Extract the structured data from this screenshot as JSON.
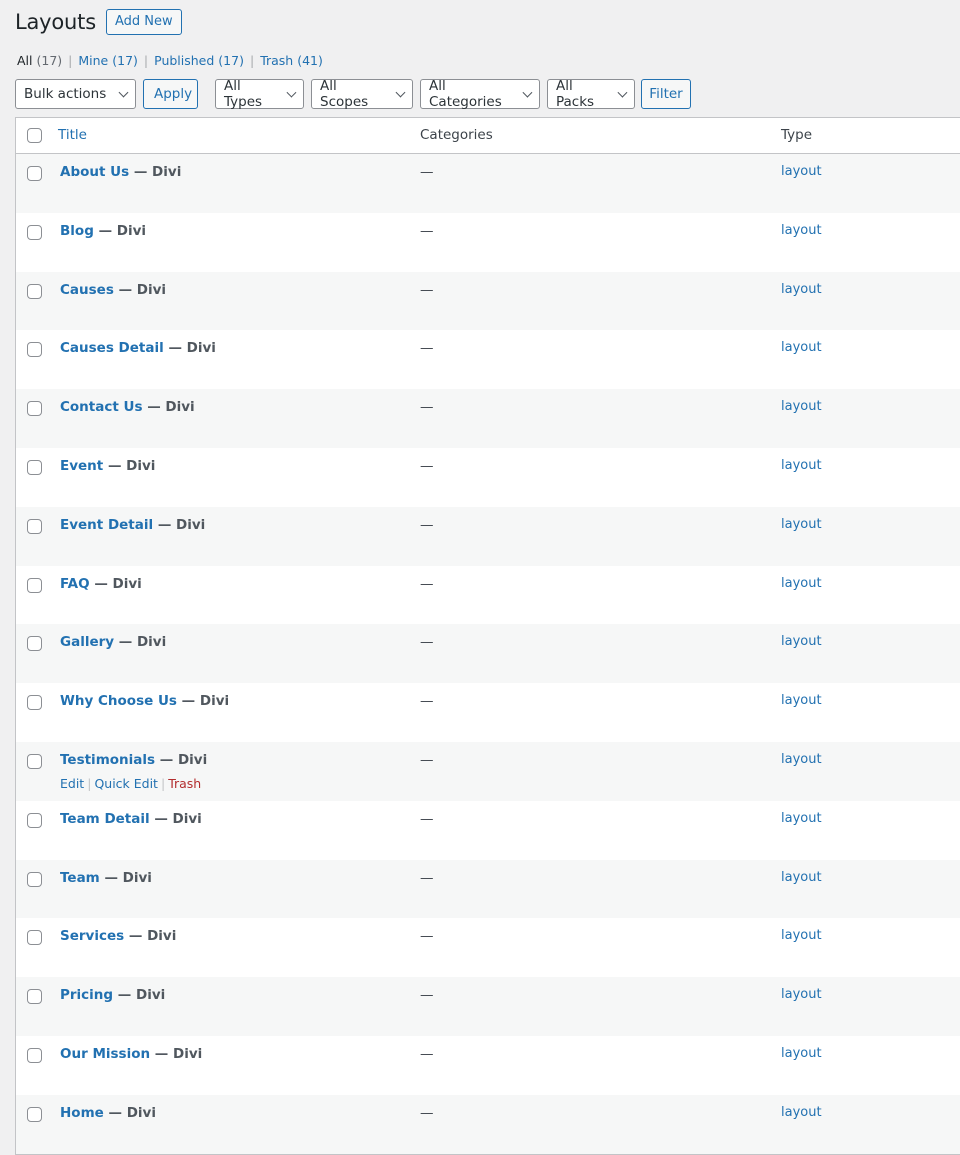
{
  "header": {
    "title": "Layouts",
    "add_new": "Add New"
  },
  "views": [
    {
      "label": "All",
      "count": "(17)",
      "current": true
    },
    {
      "label": "Mine",
      "count": "(17)",
      "current": false
    },
    {
      "label": "Published",
      "count": "(17)",
      "current": false
    },
    {
      "label": "Trash",
      "count": "(41)",
      "current": false
    }
  ],
  "tablenav": {
    "bulk_actions": "Bulk actions",
    "apply": "Apply",
    "types": "All Types",
    "scopes": "All Scopes",
    "categories": "All Categories",
    "packs": "All Packs",
    "filter": "Filter"
  },
  "columns": {
    "title": "Title",
    "categories": "Categories",
    "type": "Type"
  },
  "rows": [
    {
      "title": "About Us",
      "state": "— Divi",
      "categories": "—",
      "type": "layout"
    },
    {
      "title": "Blog",
      "state": "— Divi",
      "categories": "—",
      "type": "layout"
    },
    {
      "title": "Causes",
      "state": "— Divi",
      "categories": "—",
      "type": "layout"
    },
    {
      "title": "Causes Detail",
      "state": "— Divi",
      "categories": "—",
      "type": "layout"
    },
    {
      "title": "Contact Us",
      "state": "— Divi",
      "categories": "—",
      "type": "layout"
    },
    {
      "title": "Event",
      "state": "— Divi",
      "categories": "—",
      "type": "layout"
    },
    {
      "title": "Event Detail",
      "state": "— Divi",
      "categories": "—",
      "type": "layout"
    },
    {
      "title": "FAQ",
      "state": "— Divi",
      "categories": "—",
      "type": "layout"
    },
    {
      "title": "Gallery",
      "state": "— Divi",
      "categories": "—",
      "type": "layout"
    },
    {
      "title": "Why Choose Us",
      "state": "— Divi",
      "categories": "—",
      "type": "layout"
    },
    {
      "title": "Testimonials",
      "state": "— Divi",
      "categories": "—",
      "type": "layout",
      "actions": [
        "Edit",
        "Quick Edit",
        "Trash"
      ]
    },
    {
      "title": "Team Detail",
      "state": "— Divi",
      "categories": "—",
      "type": "layout"
    },
    {
      "title": "Team",
      "state": "— Divi",
      "categories": "—",
      "type": "layout"
    },
    {
      "title": "Services",
      "state": "— Divi",
      "categories": "—",
      "type": "layout"
    },
    {
      "title": "Pricing",
      "state": "— Divi",
      "categories": "—",
      "type": "layout"
    },
    {
      "title": "Our Mission",
      "state": "— Divi",
      "categories": "—",
      "type": "layout"
    },
    {
      "title": "Home",
      "state": "— Divi",
      "categories": "—",
      "type": "layout"
    }
  ],
  "colors": {
    "link": "#2271b1",
    "trash": "#b32d2e",
    "row_alt": "#f6f7f7",
    "page_bg": "#f0f0f1"
  }
}
